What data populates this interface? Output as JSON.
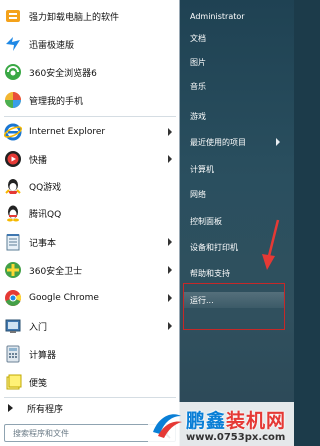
{
  "programs": [
    {
      "label": "强力卸载电脑上的软件",
      "icon": "uninstall-icon",
      "arrow": false
    },
    {
      "label": "迅雷极速版",
      "icon": "thunder-icon",
      "arrow": false
    },
    {
      "label": "360安全浏览器6",
      "icon": "360-browser-icon",
      "arrow": false
    },
    {
      "label": "管理我的手机",
      "icon": "phone-manager-icon",
      "arrow": false
    },
    {
      "label": "Internet Explorer",
      "icon": "ie-icon",
      "arrow": true
    },
    {
      "label": "快播",
      "icon": "qvod-icon",
      "arrow": true
    },
    {
      "label": "QQ游戏",
      "icon": "qq-game-icon",
      "arrow": false
    },
    {
      "label": "腾讯QQ",
      "icon": "qq-icon",
      "arrow": false
    },
    {
      "label": "记事本",
      "icon": "notepad-icon",
      "arrow": true
    },
    {
      "label": "360安全卫士",
      "icon": "360-safe-icon",
      "arrow": true
    },
    {
      "label": "Google Chrome",
      "icon": "chrome-icon",
      "arrow": true
    },
    {
      "label": "入门",
      "icon": "getting-started-icon",
      "arrow": true
    },
    {
      "label": "计算器",
      "icon": "calculator-icon",
      "arrow": false
    },
    {
      "label": "便笺",
      "icon": "sticky-notes-icon",
      "arrow": false
    }
  ],
  "all_programs": "所有程序",
  "search": {
    "placeholder": "搜索程序和文件"
  },
  "right_items": [
    {
      "label": "Administrator",
      "arrow": false
    },
    {
      "label": "文档",
      "arrow": false
    },
    {
      "label": "图片",
      "arrow": false
    },
    {
      "label": "音乐",
      "arrow": false
    },
    {
      "label": "游戏",
      "arrow": false
    },
    {
      "label": "最近使用的项目",
      "arrow": true
    },
    {
      "label": "计算机",
      "arrow": false
    },
    {
      "label": "网络",
      "arrow": false
    },
    {
      "label": "控制面板",
      "arrow": false
    },
    {
      "label": "设备和打印机",
      "arrow": false
    },
    {
      "label": "帮助和支持",
      "arrow": false
    },
    {
      "label": "运行...",
      "arrow": false
    }
  ],
  "watermark": {
    "brand_a": "鹏鑫",
    "brand_b": "装机网",
    "url": "www.0753px.com"
  },
  "colors": {
    "highlight": "#c62828",
    "right_pane": "#2a4f5f",
    "watermark_blue": "#0a7fd6"
  }
}
